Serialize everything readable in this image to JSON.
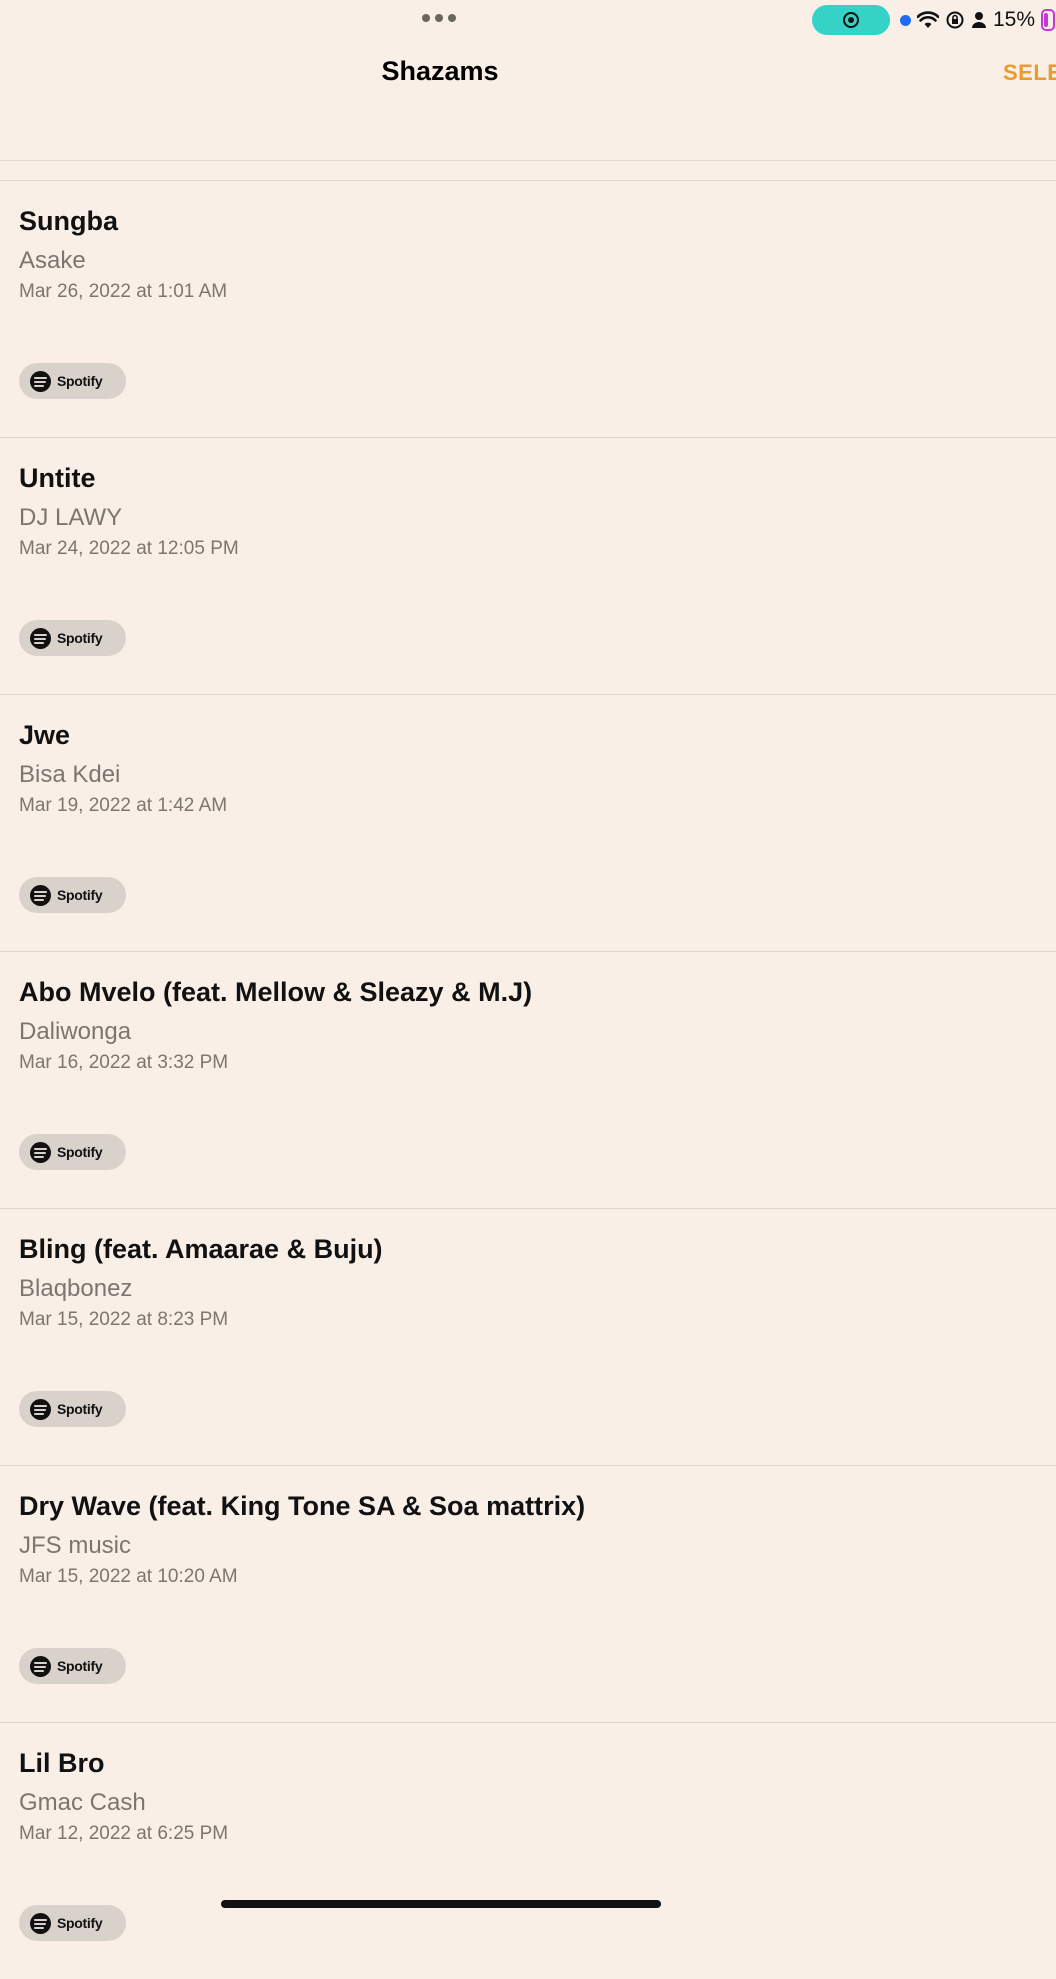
{
  "status": {
    "battery_percent": "15%",
    "colors": {
      "record_pill": "#35d2c6",
      "location_dot": "#1f6cf0",
      "battery": "#c13bd2"
    }
  },
  "nav": {
    "title": "Shazams",
    "select_label": "SELECT",
    "accent_color": "#eb9a2c"
  },
  "shazams": [
    {
      "title": "Sungba",
      "artist": "Asake",
      "date": "Mar 26, 2022 at 1:01 AM",
      "button_label": "Spotify"
    },
    {
      "title": "Untite",
      "artist": "DJ LAWY",
      "date": "Mar 24, 2022 at 12:05 PM",
      "button_label": "Spotify"
    },
    {
      "title": "Jwe",
      "artist": "Bisa Kdei",
      "date": "Mar 19, 2022 at 1:42 AM",
      "button_label": "Spotify"
    },
    {
      "title": "Abo Mvelo (feat. Mellow & Sleazy & M.J)",
      "artist": "Daliwonga",
      "date": "Mar 16, 2022 at 3:32 PM",
      "button_label": "Spotify"
    },
    {
      "title": "Bling (feat. Amaarae & Buju)",
      "artist": "Blaqbonez",
      "date": "Mar 15, 2022 at 8:23 PM",
      "button_label": "Spotify"
    },
    {
      "title": "Dry Wave (feat. King Tone SA & Soa mattrix)",
      "artist": "JFS music",
      "date": "Mar 15, 2022 at 10:20 AM",
      "button_label": "Spotify"
    },
    {
      "title": "Lil Bro",
      "artist": "Gmac Cash",
      "date": "Mar 12, 2022 at 6:25 PM",
      "button_label": "Spotify"
    }
  ],
  "icons": {
    "status": [
      "multitask-dots-icon",
      "screen-record-icon",
      "location-dot-icon",
      "wifi-icon",
      "orientation-lock-icon",
      "person-icon",
      "battery-icon"
    ],
    "list_item": "spotify-logo-icon"
  }
}
